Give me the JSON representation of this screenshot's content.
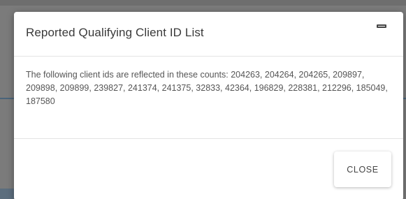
{
  "dialog": {
    "title": "Reported Qualifying Client ID List",
    "message": "The following client ids are reflected in these counts: 204263, 204264, 204265, 209897, 209898, 209899, 239827, 241374, 241375, 32833, 42364, 196829, 228381, 212296, 185049, 187580",
    "minimize_icon": "minimize-icon",
    "close_label": "CLOSE"
  },
  "colors": {
    "overlay": "#7b7b7b",
    "title_text": "#3a3a3a",
    "body_text": "#555555",
    "divider": "#e3e3e3"
  }
}
